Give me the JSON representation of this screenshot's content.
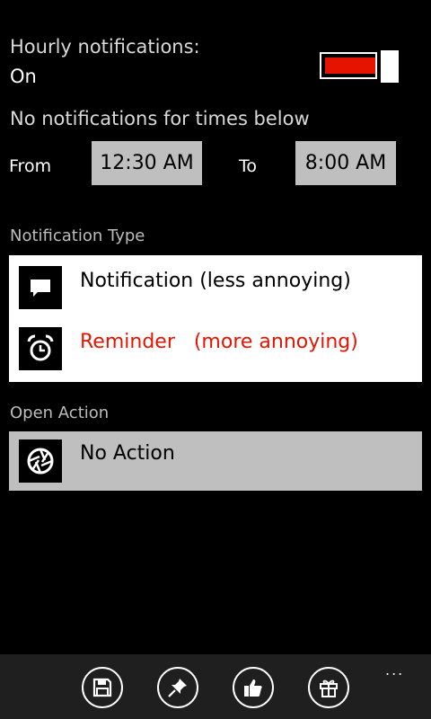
{
  "hourly": {
    "label": "Hourly notifications:",
    "value": "On",
    "toggle_on": true,
    "toggle_color": "#e51400"
  },
  "quiet_hours": {
    "label": "No notifications for times below",
    "from_label": "From",
    "from_time": "12:30 AM",
    "to_label": "To",
    "to_time": "8:00 AM"
  },
  "notification_type": {
    "title": "Notification Type",
    "options": [
      {
        "label": "Notification (less annoying)",
        "icon": "speech-bubble-icon",
        "selected": false
      },
      {
        "label": "Reminder   (more annoying)",
        "icon": "alarm-clock-icon",
        "selected": true,
        "color": "#e51400"
      }
    ]
  },
  "open_action": {
    "title": "Open Action",
    "selected": {
      "label": "No Action",
      "icon": "aperture-icon"
    }
  },
  "appbar": {
    "buttons": [
      "save-icon",
      "pin-icon",
      "thumbs-up-icon",
      "gift-icon"
    ],
    "more": "..."
  }
}
